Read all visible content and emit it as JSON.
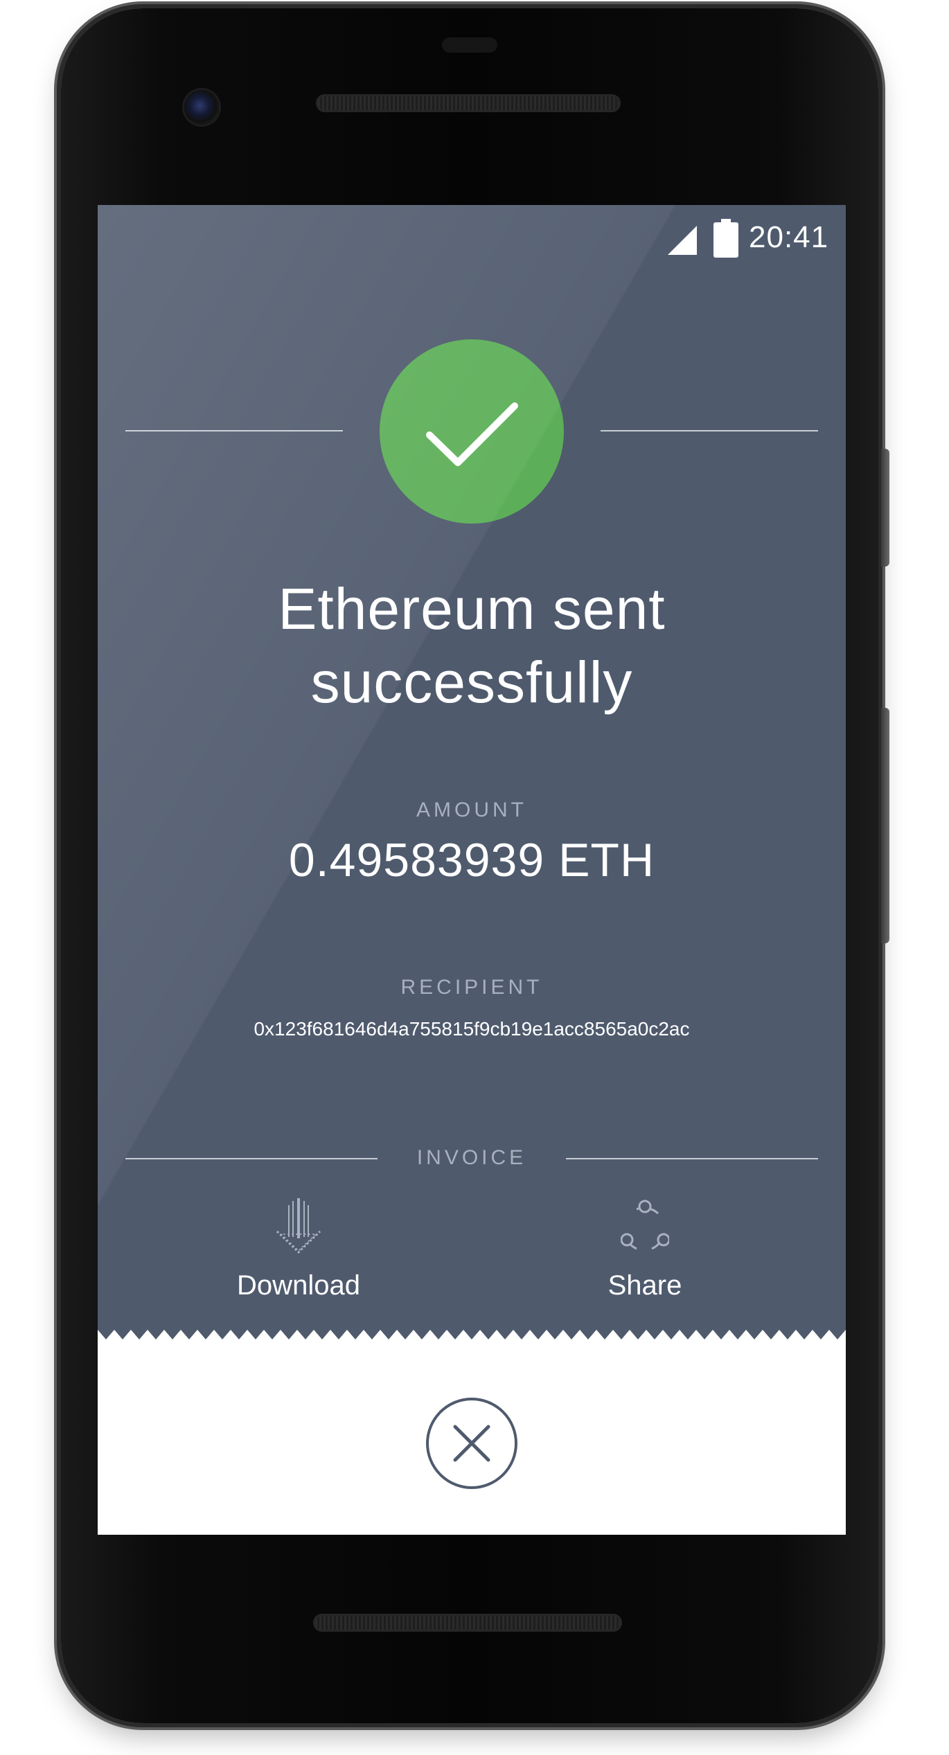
{
  "status_bar": {
    "time": "20:41",
    "signal_icon": "cellular-signal-icon",
    "battery_icon": "battery-icon"
  },
  "confirmation": {
    "icon": "check-icon",
    "icon_color": "#5caf58",
    "title_line1": "Ethereum sent",
    "title_line2": "successfully"
  },
  "amount": {
    "label": "AMOUNT",
    "value": "0.49583939 ETH"
  },
  "recipient": {
    "label": "RECIPIENT",
    "address": "0x123f681646d4a755815f9cb19e1acc8565a0c2ac"
  },
  "invoice": {
    "label": "INVOICE",
    "download_label": "Download",
    "download_icon": "download-arrow-icon",
    "share_label": "Share",
    "share_icon": "share-icon"
  },
  "close": {
    "icon": "close-icon"
  },
  "colors": {
    "screen_background": "#4f5a6d",
    "success_green": "#5caf58",
    "caption_gray": "#a9b1bf",
    "panel_white": "#ffffff"
  }
}
